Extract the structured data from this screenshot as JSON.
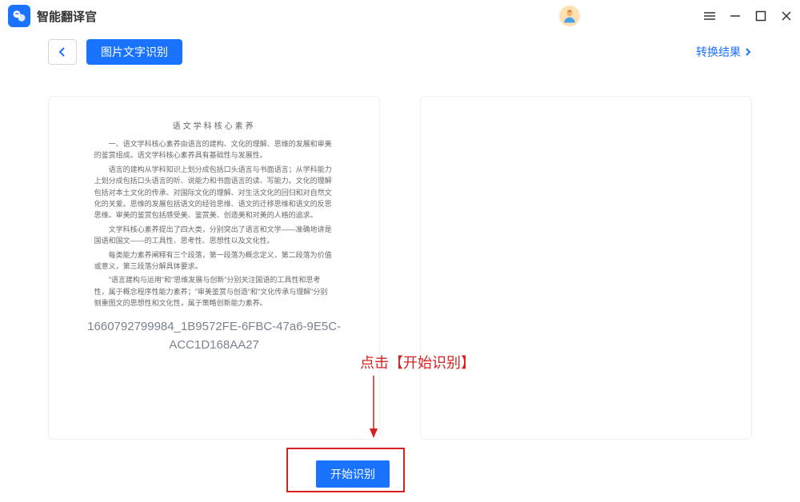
{
  "app": {
    "title": "智能翻译官"
  },
  "toolbar": {
    "page_title": "图片文字识别",
    "result_link": "转换结果"
  },
  "left_panel": {
    "doc": {
      "heading": "语文学科核心素养",
      "p1": "一、语文学科核心素养由语言的建构、文化的理解、思维的发展和审美的鉴赏组成。语文学科核心素养具有基础性与发展性。",
      "p2": "语言的建构从学科知识上划分成包括口头语言与书面语言；从学科能力上划分成包括口头语言的听、说能力和书面语言的读、写能力。文化的理解包括对本土文化的传承、对国际文化的理解、对生活文化的回归和对自然文化的关爱。思维的发展包括语文的经验思维、语文的迁移思维和语文的反思思维。审美的鉴赏包括感受美、鉴赏美、创造美和对美的人格的追求。",
      "p3": "文学科核心素养提出了四大类，分别突出了语言和文学——准确地讲是国语和国文——的工具性、思考性、思想性以及文化性。",
      "p4": "每类能力素养阐释有三个段落，第一段落为概念定义，第二段落为价值或意义，第三段落分解具体要求。",
      "p5": "\"语言建构与运用\"和\"思维发展与创新\"分别关注国语的工具性和思考性，属于概念程序性能力素养；\"审美鉴赏与创造\"和\"文化传承与理解\"分别侧重图文的思想性和文化性，属于策略创新能力素养。"
    },
    "filename_line1": "1660792799984_1B9572FE-6FBC-47a6-9E5C-",
    "filename_line2": "ACC1D168AA27"
  },
  "annotation": {
    "label": "点击【开始识别】"
  },
  "actions": {
    "start_button": "开始识别"
  }
}
